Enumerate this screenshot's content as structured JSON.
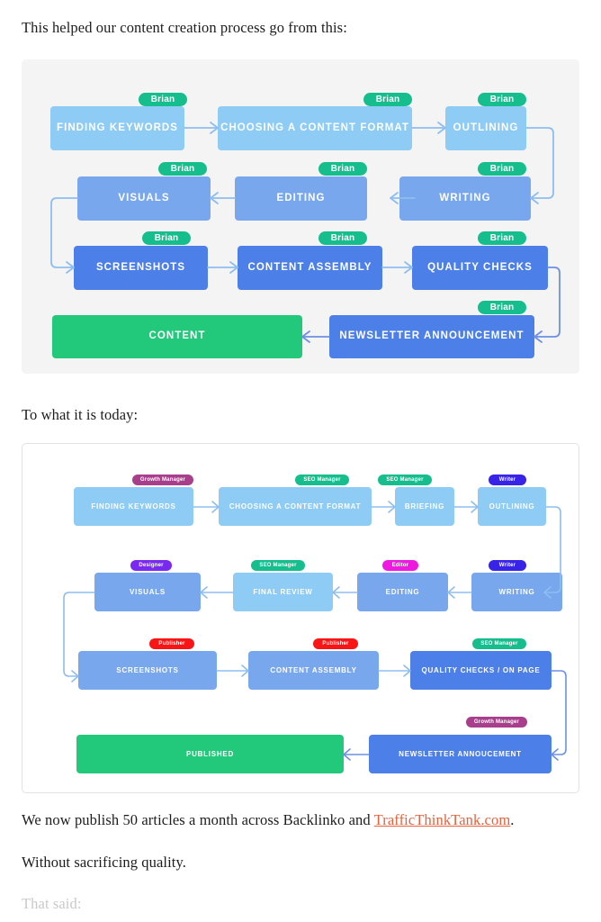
{
  "paragraphs": [
    {
      "id": "intro",
      "text": "This helped our content creation process go from this:"
    },
    {
      "id": "today",
      "text": "To what it is today:"
    },
    {
      "id": "stats_pre",
      "text": "We now publish 50 articles a month across Backlinko and "
    },
    {
      "id": "stats_link",
      "text": "TrafficThinkTank.com"
    },
    {
      "id": "stats_post",
      "text": "."
    },
    {
      "id": "quality",
      "text": "Without sacrificing quality."
    },
    {
      "id": "that_said",
      "text": "That said:"
    }
  ],
  "colors": {
    "node_light": "#8ECBF5",
    "node_mid": "#79A7EE",
    "node_strong": "#4D7FE8",
    "node_green": "#22C97A",
    "badge_green": "#16BE8D",
    "badge_purple": "#7A2AF0",
    "badge_magenta": "#A93E8C",
    "badge_pink": "#EE18E0",
    "badge_blue": "#3823E8",
    "badge_red": "#F91515",
    "connector": "#8EBDF0",
    "connector_dark": "#6E8FE4",
    "panel_grey": "#f4f4f4",
    "panel_white": "#ffffff",
    "panel_border": "#e2e2e2",
    "link": "#e8603c",
    "text": "#1d1d1d",
    "text_faded": "#c9c9c9"
  },
  "diagram_old": {
    "title": "content-process-before",
    "owner_label": "Brian",
    "nodes": [
      {
        "label": "FINDING KEYWORDS",
        "owner": "Brian",
        "tone": "light"
      },
      {
        "label": "CHOOSING A CONTENT FORMAT",
        "owner": "Brian",
        "tone": "light"
      },
      {
        "label": "OUTLINING",
        "owner": "Brian",
        "tone": "light"
      },
      {
        "label": "WRITING",
        "owner": "Brian",
        "tone": "mid"
      },
      {
        "label": "EDITING",
        "owner": "Brian",
        "tone": "mid"
      },
      {
        "label": "VISUALS",
        "owner": "Brian",
        "tone": "mid"
      },
      {
        "label": "SCREENSHOTS",
        "owner": "Brian",
        "tone": "strong"
      },
      {
        "label": "CONTENT ASSEMBLY",
        "owner": "Brian",
        "tone": "strong"
      },
      {
        "label": "QUALITY CHECKS",
        "owner": "Brian",
        "tone": "strong"
      },
      {
        "label": "NEWSLETTER ANNOUNCEMENT",
        "owner": "Brian",
        "tone": "strong"
      },
      {
        "label": "CONTENT",
        "owner": "",
        "tone": "green"
      }
    ]
  },
  "diagram_new": {
    "title": "content-process-after",
    "nodes": [
      {
        "label": "FINDING KEYWORDS",
        "owner": "Growth Manager",
        "tone": "light"
      },
      {
        "label": "CHOOSING A CONTENT FORMAT",
        "owner": "SEO Manager",
        "tone": "light"
      },
      {
        "label": "BRIEFING",
        "owner": "SEO Manager",
        "tone": "light"
      },
      {
        "label": "OUTLINING",
        "owner": "Writer",
        "tone": "light"
      },
      {
        "label": "WRITING",
        "owner": "Writer",
        "tone": "mid"
      },
      {
        "label": "EDITING",
        "owner": "Editor",
        "tone": "mid"
      },
      {
        "label": "FINAL REVIEW",
        "owner": "SEO Manager",
        "tone": "light"
      },
      {
        "label": "VISUALS",
        "owner": "Designer",
        "tone": "mid"
      },
      {
        "label": "SCREENSHOTS",
        "owner": "Publisher",
        "tone": "mid"
      },
      {
        "label": "CONTENT ASSEMBLY",
        "owner": "Publisher",
        "tone": "mid"
      },
      {
        "label": "QUALITY CHECKS / ON PAGE",
        "owner": "SEO Manager",
        "tone": "strong"
      },
      {
        "label": "NEWSLETTER ANNOUCEMENT",
        "owner": "Growth Manager",
        "tone": "strong"
      },
      {
        "label": "PUBLISHED",
        "owner": "",
        "tone": "green"
      }
    ],
    "roles": [
      "Growth Manager",
      "SEO Manager",
      "Writer",
      "Editor",
      "Designer",
      "Publisher"
    ]
  }
}
